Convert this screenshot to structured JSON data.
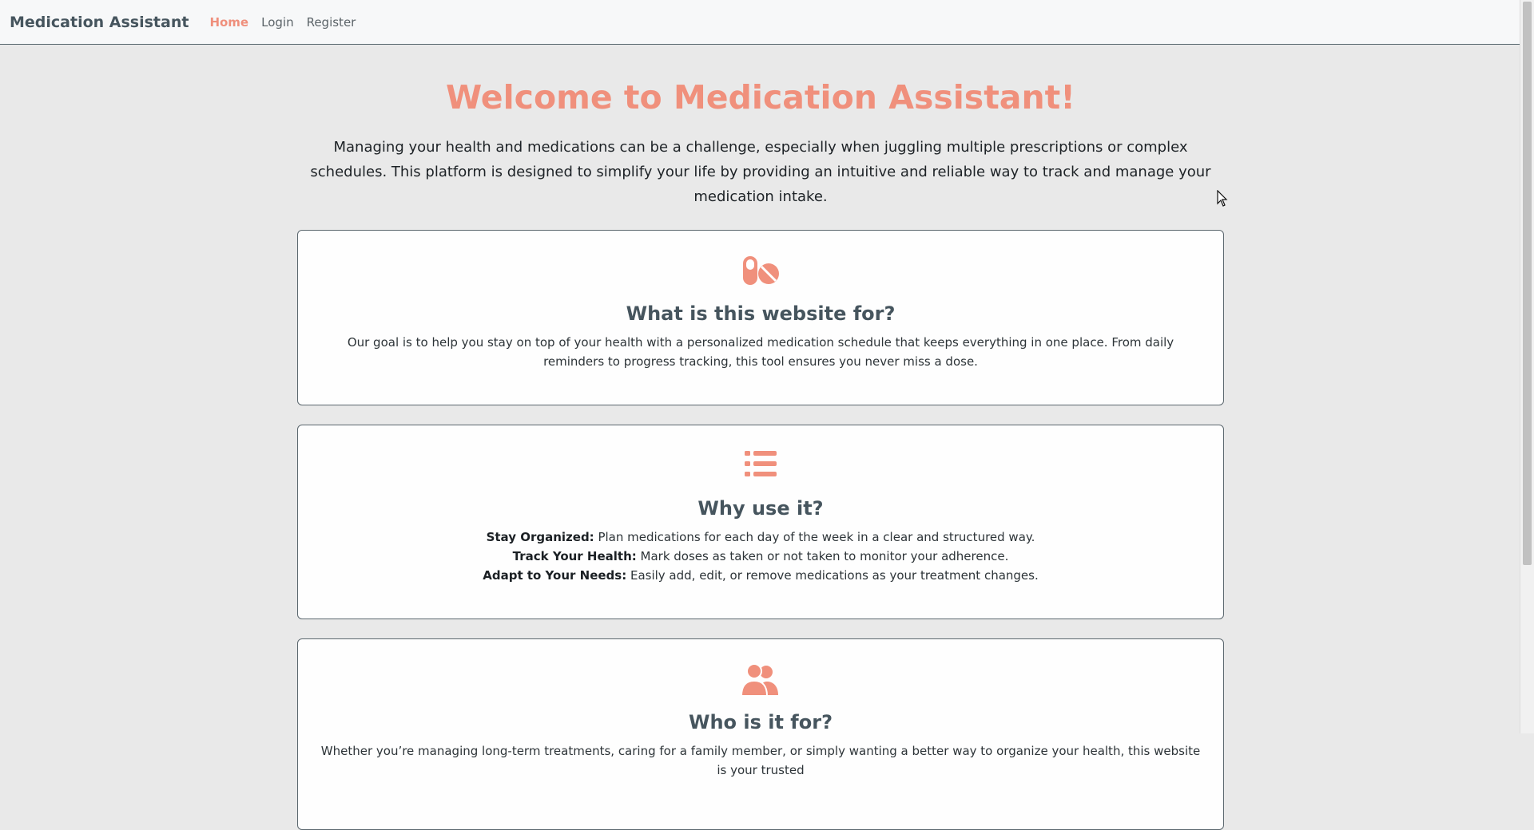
{
  "nav": {
    "brand": "Medication Assistant",
    "links": [
      {
        "label": "Home",
        "active": true
      },
      {
        "label": "Login",
        "active": false
      },
      {
        "label": "Register",
        "active": false
      }
    ]
  },
  "hero": {
    "title": "Welcome to Medication Assistant!",
    "text": "Managing your health and medications can be a challenge, especially when juggling multiple prescriptions or complex schedules. This platform is designed to simplify your life by providing an intuitive and reliable way to track and manage your medication intake."
  },
  "cards": [
    {
      "icon": "pills-icon",
      "title": "What is this website for?",
      "text": "Our goal is to help you stay on top of your health with a personalized medication schedule that keeps everything in one place. From daily reminders to progress tracking, this tool ensures you never miss a dose."
    },
    {
      "icon": "list-icon",
      "title": "Why use it?",
      "reasons": [
        {
          "label": "Stay Organized:",
          "text": " Plan medications for each day of the week in a clear and structured way."
        },
        {
          "label": "Track Your Health:",
          "text": " Mark doses as taken or not taken to monitor your adherence."
        },
        {
          "label": "Adapt to Your Needs:",
          "text": " Easily add, edit, or remove medications as your treatment changes."
        }
      ]
    },
    {
      "icon": "users-icon",
      "title": "Who is it for?",
      "text": "Whether you’re managing long-term treatments, caring for a family member, or simply wanting a better way to organize your health, this website is your trusted"
    }
  ],
  "colors": {
    "accent": "#f0907c",
    "heading": "#46555e",
    "background": "#e9e9e9"
  }
}
